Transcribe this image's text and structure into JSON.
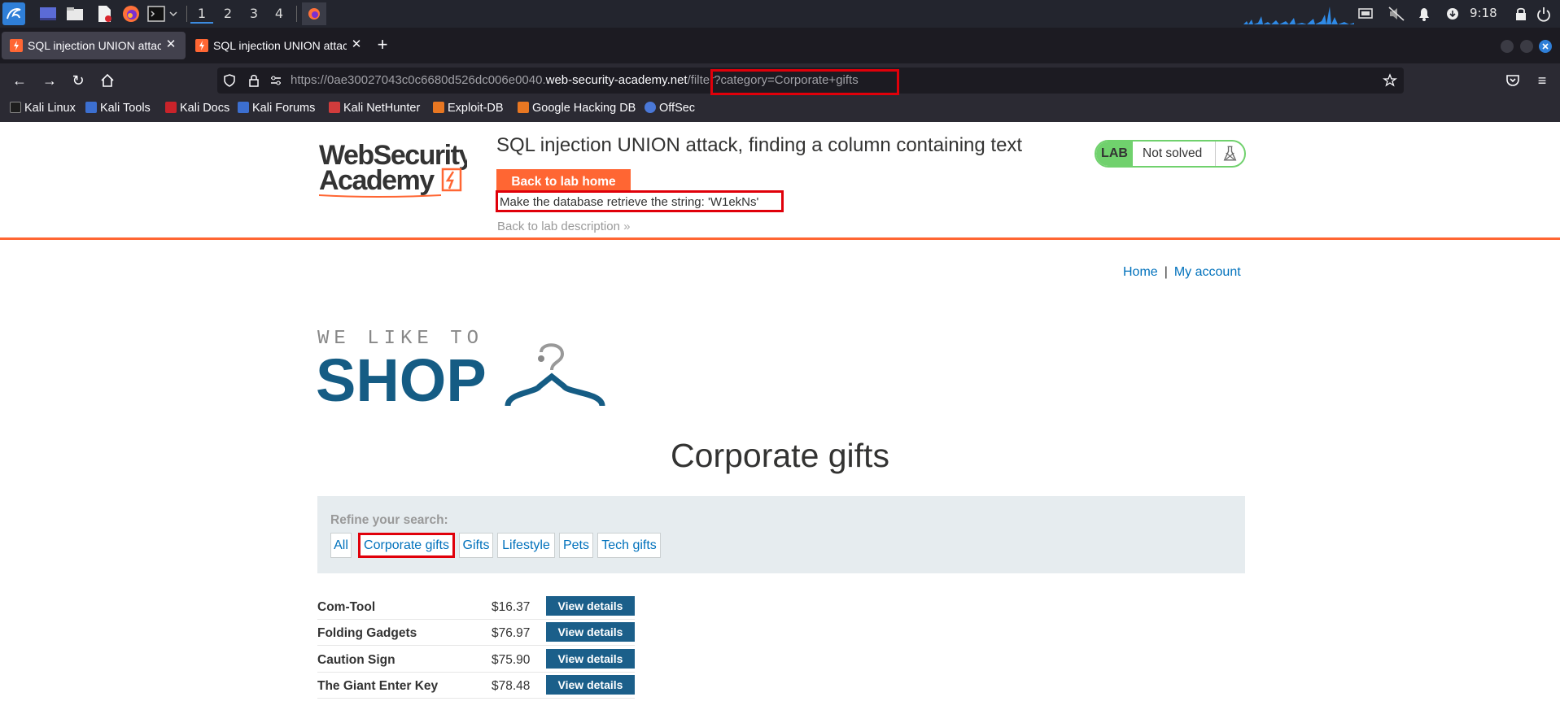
{
  "taskbar": {
    "workspaces": [
      "1",
      "2",
      "3",
      "4"
    ],
    "clock": "9:18"
  },
  "tabs": [
    {
      "title": "SQL injection UNION attack",
      "active": true
    },
    {
      "title": "SQL injection UNION attack",
      "active": false
    }
  ],
  "url": {
    "prefix": "https://0ae30027043c0c6680d526dc006e0040.",
    "domain": "web-security-academy.net",
    "path": "/filter?category=Corporate+gifts"
  },
  "bookmarks": [
    "Kali Linux",
    "Kali Tools",
    "Kali Docs",
    "Kali Forums",
    "Kali NetHunter",
    "Exploit-DB",
    "Google Hacking DB",
    "OffSec"
  ],
  "lab": {
    "logo_line1": "WebSecurity",
    "logo_line2": "Academy",
    "title": "SQL injection UNION attack, finding a column containing text",
    "back_home": "Back to lab home",
    "objective": "Make the database retrieve the string: 'W1ekNs'",
    "back_description": "Back to lab description",
    "badge": "LAB",
    "status": "Not solved"
  },
  "top_links": {
    "home": "Home",
    "separator": "|",
    "account": "My account"
  },
  "shop_logo": {
    "tagline": "WE LIKE TO",
    "word": "SHOP"
  },
  "category_title": "Corporate gifts",
  "refine": {
    "label": "Refine your search:",
    "filters": [
      "All",
      "Corporate gifts",
      "Gifts",
      "Lifestyle",
      "Pets",
      "Tech gifts"
    ],
    "selected": "Corporate gifts"
  },
  "products": [
    {
      "name": "Com-Tool",
      "price": "$16.37",
      "button": "View details"
    },
    {
      "name": "Folding Gadgets",
      "price": "$76.97",
      "button": "View details"
    },
    {
      "name": "Caution Sign",
      "price": "$75.90",
      "button": "View details"
    },
    {
      "name": "The Giant Enter Key",
      "price": "$78.48",
      "button": "View details"
    }
  ],
  "colors": {
    "accent_orange": "#ff6633",
    "link_blue": "#0071bc",
    "button_blue": "#1b5f8a",
    "lab_green": "#70d16d",
    "highlight_red": "#e0000a"
  }
}
